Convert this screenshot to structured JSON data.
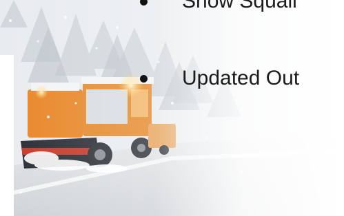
{
  "slide": {
    "bullets": [
      {
        "text": "Snow Squall"
      },
      {
        "text": "Updated Out"
      }
    ]
  },
  "icons": [
    "bullet-dot-icon",
    "bullet-dot-icon"
  ],
  "colors": {
    "text": "#1b1b1b",
    "truck_orange": "#e8872a",
    "snow": "#ffffff"
  }
}
